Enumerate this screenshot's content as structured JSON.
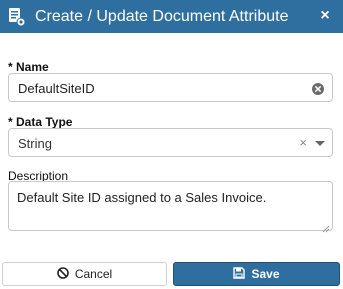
{
  "dialog": {
    "title": "Create / Update Document Attribute",
    "header_color": "#2f6f9f",
    "close_icon": "×"
  },
  "form": {
    "name": {
      "label": "* Name",
      "value": "DefaultSiteID"
    },
    "data_type": {
      "label": "* Data Type",
      "value": "String",
      "clear_glyph": "×"
    },
    "description": {
      "label": "Description",
      "value": "Default Site ID assigned to a Sales Invoice."
    }
  },
  "buttons": {
    "cancel_label": "Cancel",
    "save_label": "Save",
    "save_color": "#2f6f9f"
  },
  "icons": {
    "header": "document-gear-icon",
    "name_clear": "clear-circle-icon",
    "cancel": "ban-icon",
    "save": "floppy-disk-icon"
  }
}
